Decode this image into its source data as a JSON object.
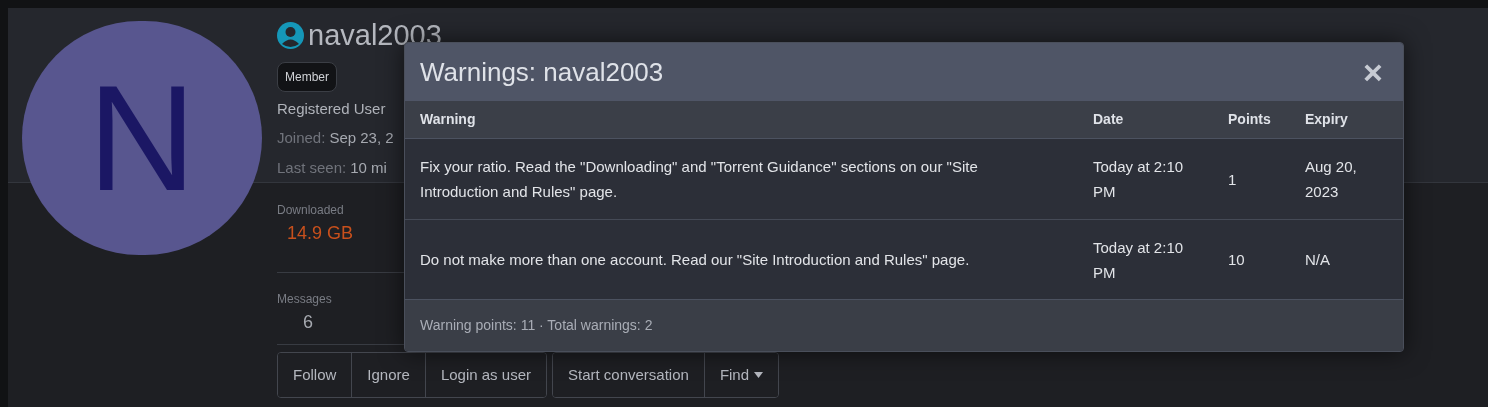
{
  "profile": {
    "avatar_letter": "N",
    "username": "naval2003",
    "badge": "Member",
    "title": "Registered User",
    "joined_label": "Joined:",
    "joined": "Sep 23, 2",
    "last_seen_label": "Last seen:",
    "last_seen": "10 mi"
  },
  "stats": [
    {
      "label": "Downloaded",
      "value": "14.9 GB",
      "kind": "alert"
    },
    {
      "label": "Messages",
      "value": "6",
      "kind": "plain"
    }
  ],
  "button_groups": [
    {
      "buttons": [
        {
          "label": "Follow",
          "caret": false
        },
        {
          "label": "Ignore",
          "caret": false
        },
        {
          "label": "Login as user",
          "caret": false
        }
      ]
    },
    {
      "buttons": [
        {
          "label": "Start conversation",
          "caret": false
        },
        {
          "label": "Find",
          "caret": true
        }
      ]
    }
  ],
  "modal": {
    "title": "Warnings: naval2003",
    "close": "×",
    "columns": [
      "Warning",
      "Date",
      "Points",
      "Expiry"
    ],
    "rows": [
      [
        "Fix your ratio. Read the \"Downloading\" and \"Torrent Guidance\" sections on our \"Site Introduction and Rules\" page.",
        "Today at 2:10 PM",
        "1",
        "Aug 20, 2023"
      ],
      [
        "Do not make more than one account. Read our \"Site Introduction and Rules\" page.",
        "Today at 2:10 PM",
        "10",
        "N/A"
      ]
    ],
    "footer": "Warning points: 11 · Total warnings: 2"
  }
}
